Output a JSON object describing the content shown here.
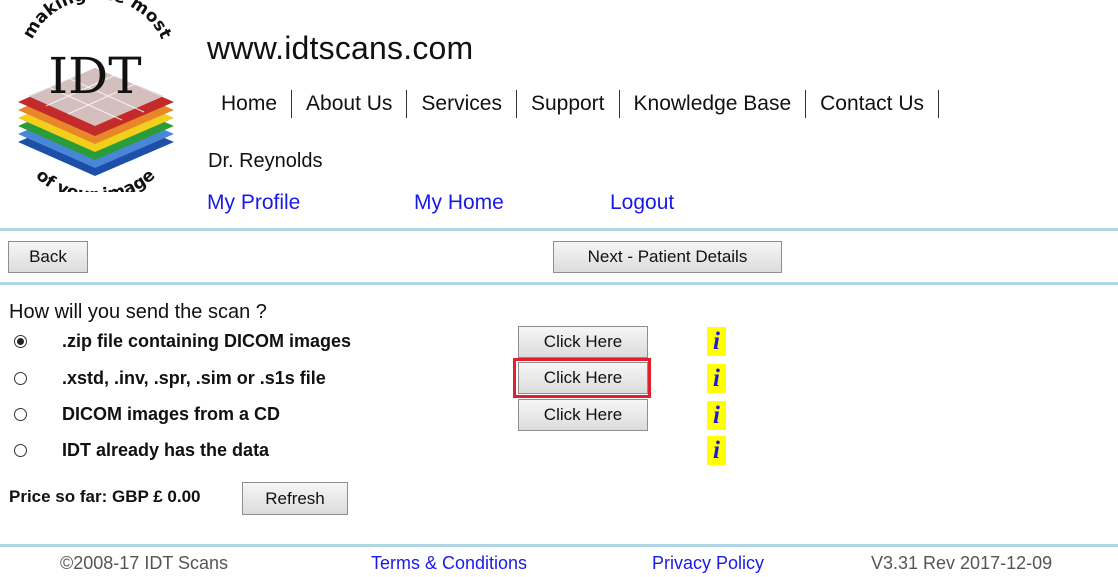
{
  "logo": {
    "text_top": "making the most",
    "text_main": "IDT",
    "text_bottom": "of your image"
  },
  "header": {
    "site_title": "www.idtscans.com",
    "nav": [
      {
        "label": "Home"
      },
      {
        "label": "About Us"
      },
      {
        "label": "Services"
      },
      {
        "label": "Support"
      },
      {
        "label": "Knowledge Base"
      },
      {
        "label": "Contact Us"
      }
    ]
  },
  "user": {
    "name": "Dr. Reynolds",
    "links": {
      "profile": "My Profile",
      "home": "My Home",
      "logout": "Logout"
    }
  },
  "toolbar": {
    "back_label": "Back",
    "next_label": "Next - Patient Details"
  },
  "form": {
    "question": "How will you send the scan ?",
    "options": [
      {
        "label": ".zip file containing DICOM images",
        "checked": true
      },
      {
        "label": ".xstd, .inv, .spr, .sim or .s1s file",
        "checked": false
      },
      {
        "label": "DICOM images from a CD",
        "checked": false
      },
      {
        "label": "IDT already has the data",
        "checked": false
      }
    ],
    "click_buttons": [
      "Click Here",
      "Click Here",
      "Click Here"
    ],
    "info_glyph": "i",
    "price_label": "Price so far: GBP £ 0.00",
    "refresh_label": "Refresh"
  },
  "footer": {
    "copyright": "©2008-17 IDT Scans",
    "terms": "Terms & Conditions",
    "privacy": "Privacy Policy",
    "version": "V3.31 Rev 2017-12-09"
  },
  "colors": {
    "link": "#1a1ae8",
    "rule": "#aed6e4",
    "highlight": "#e0202a",
    "info_bg": "#ffff00",
    "info_fg": "#1a1adc"
  }
}
